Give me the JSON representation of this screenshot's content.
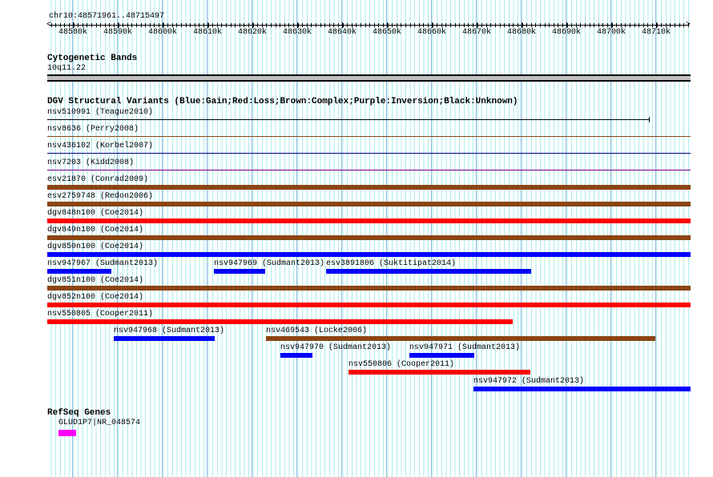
{
  "ruler": {
    "range": "chr10:48571961..48715497",
    "ticks": [
      "48580k",
      "48590k",
      "48600k",
      "48610k",
      "48620k",
      "48630k",
      "48640k",
      "48650k",
      "48660k",
      "48670k",
      "48680k",
      "48690k",
      "48700k",
      "48710k"
    ]
  },
  "cyto": {
    "title": "Cytogenetic Bands",
    "band": "10q11.22"
  },
  "dgv": {
    "title": "DGV Structural Variants (Blue:Gain;Red:Loss;Brown:Complex;Purple:Inversion;Black:Unknown)",
    "features": [
      "nsv510991 (Teague2010)",
      "nsv8636 (Perry2008)",
      "nsv436102 (Korbel2007)",
      "nsv7203 (Kidd2008)",
      "esv21870 (Conrad2009)",
      "esv2759748 (Redon2006)",
      "dgv848n100 (Coe2014)",
      "dgv849n100 (Coe2014)",
      "dgv850n100 (Coe2014)",
      "nsv947967 (Sudmant2013)",
      "nsv947969 (Sudmant2013)",
      "esv3891806 (Suktitipat2014)",
      "dgv851n100 (Coe2014)",
      "dgv852n100 (Coe2014)",
      "nsv550805 (Cooper2011)",
      "nsv947968 (Sudmant2013)",
      "nsv469543 (Locke2006)",
      "nsv947970 (Sudmant2013)",
      "nsv947971 (Sudmant2013)",
      "nsv550806 (Cooper2011)",
      "nsv947972 (Sudmant2013)"
    ]
  },
  "refseq": {
    "title": "RefSeq Genes",
    "gene": "GLUD1P7|NR_048574"
  },
  "colors": {
    "gain": "#0000ff",
    "loss": "#ff0000",
    "complex": "#8b4513",
    "inversion": "#800080",
    "unknown": "#000000",
    "gene": "#ff00ff"
  }
}
